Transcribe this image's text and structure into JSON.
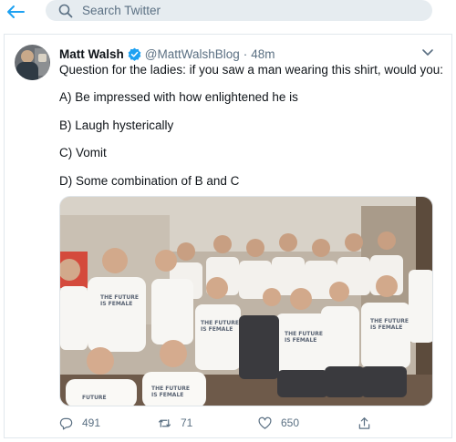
{
  "topbar": {
    "search_placeholder": "Search Twitter"
  },
  "tweet": {
    "author_name": "Matt Walsh",
    "handle": "@MattWalshBlog",
    "separator": "·",
    "time": "48m",
    "lines": [
      "Question for the ladies: if you saw a man wearing this shirt, would you:",
      "A) Be impressed with how enlightened he is",
      "B) Laugh hysterically",
      "C) Vomit",
      "D) Some combination of B and C"
    ],
    "shirt_text": "THE FUTURE IS FEMALE",
    "stats": {
      "replies": "491",
      "retweets": "71",
      "likes": "650"
    }
  },
  "colors": {
    "accent": "#1da1f2",
    "muted": "#5b7083",
    "search_bg": "#e6ecf0",
    "border": "#e1e8ed"
  },
  "icons": [
    "back-arrow-icon",
    "search-icon",
    "verified-badge-icon",
    "chevron-down-icon",
    "reply-icon",
    "retweet-icon",
    "like-icon",
    "share-icon"
  ]
}
